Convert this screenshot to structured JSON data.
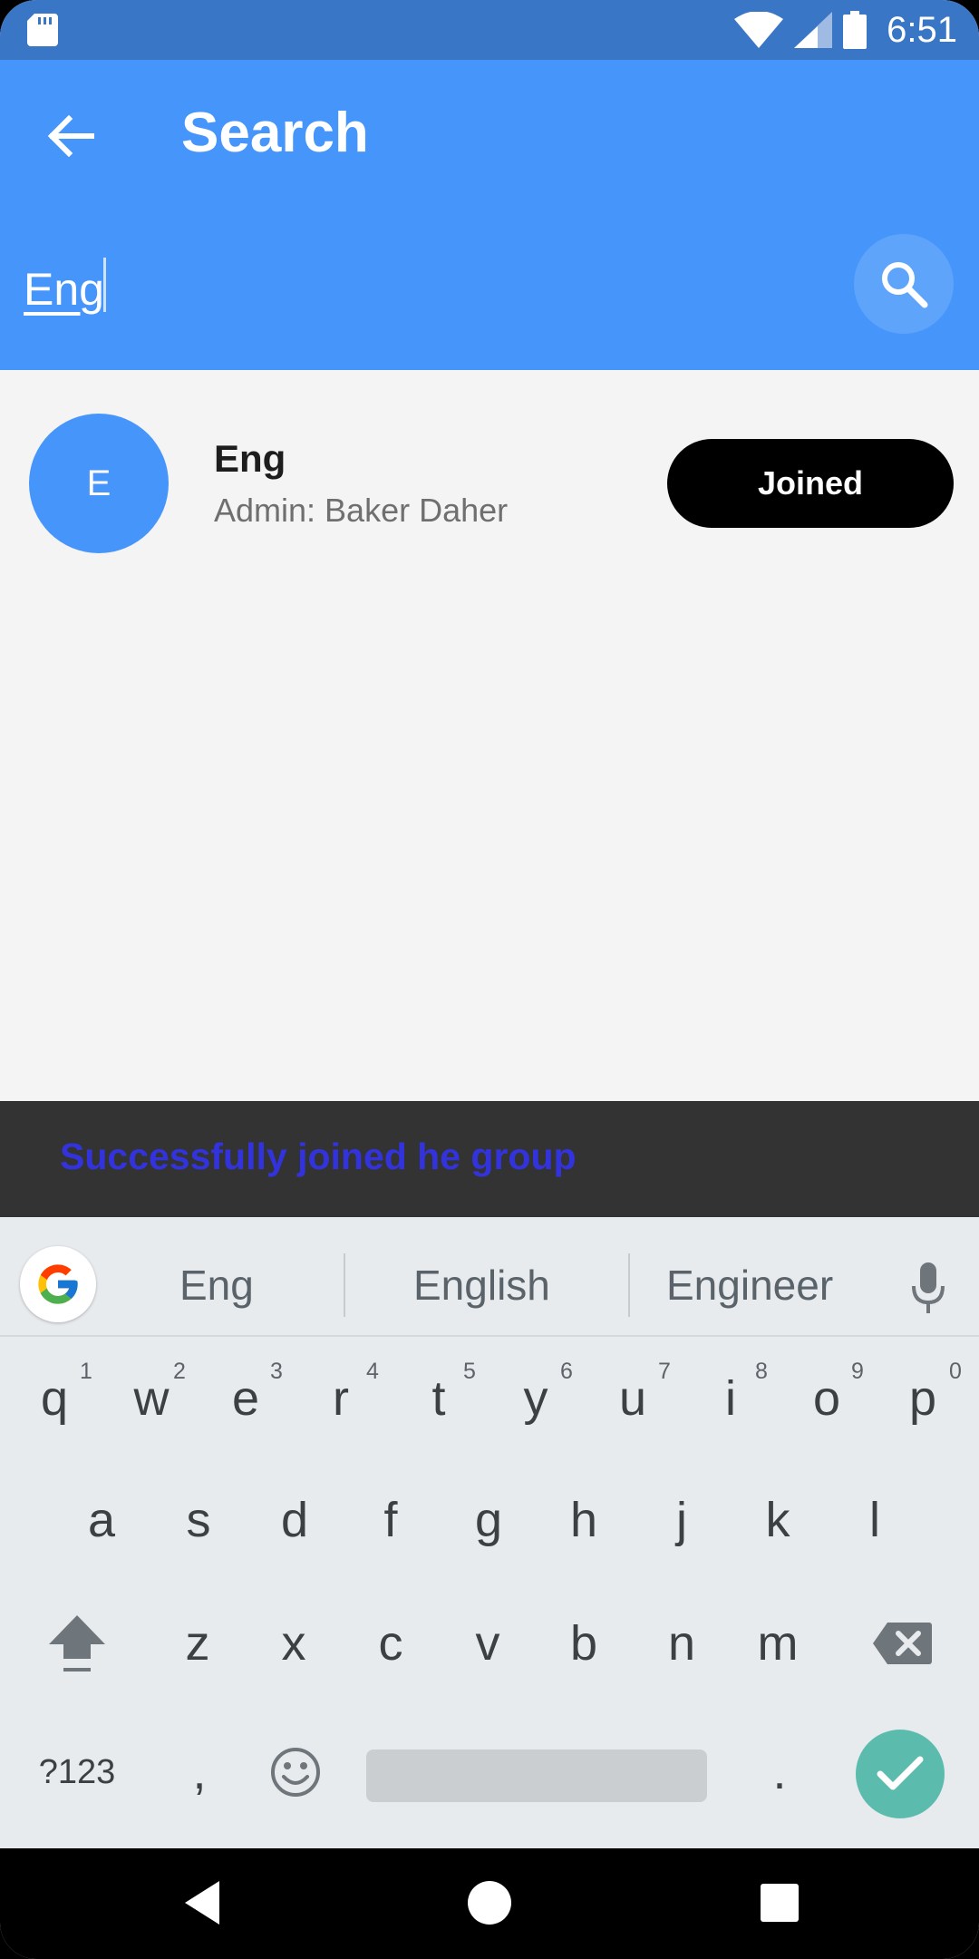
{
  "status_bar": {
    "time": "6:51",
    "icons": [
      "sd-card-icon",
      "wifi-icon",
      "signal-icon",
      "battery-icon"
    ]
  },
  "app_bar": {
    "title": "Search",
    "search_value": "Eng",
    "back_icon": "arrow-left-icon",
    "search_icon": "search-icon"
  },
  "results": [
    {
      "avatar_letter": "E",
      "name": "Eng",
      "admin": "Admin: Baker Daher",
      "action_label": "Joined"
    }
  ],
  "snackbar": {
    "message": "Successfully joined he group"
  },
  "keyboard": {
    "suggestions": [
      "Eng",
      "English",
      "Engineer"
    ],
    "row1": [
      "q",
      "w",
      "e",
      "r",
      "t",
      "y",
      "u",
      "i",
      "o",
      "p"
    ],
    "row1_hints": [
      "1",
      "2",
      "3",
      "4",
      "5",
      "6",
      "7",
      "8",
      "9",
      "0"
    ],
    "row2": [
      "a",
      "s",
      "d",
      "f",
      "g",
      "h",
      "j",
      "k",
      "l"
    ],
    "row3": [
      "z",
      "x",
      "c",
      "v",
      "b",
      "n",
      "m"
    ],
    "symbols_key": "?123",
    "comma_key": ",",
    "period_key": "."
  },
  "colors": {
    "status_bar": "#3a76c6",
    "app_bar": "#4595fb",
    "snackbar_bg": "#333333",
    "snackbar_text": "#3333dd",
    "enter_key": "#5bbcae"
  }
}
